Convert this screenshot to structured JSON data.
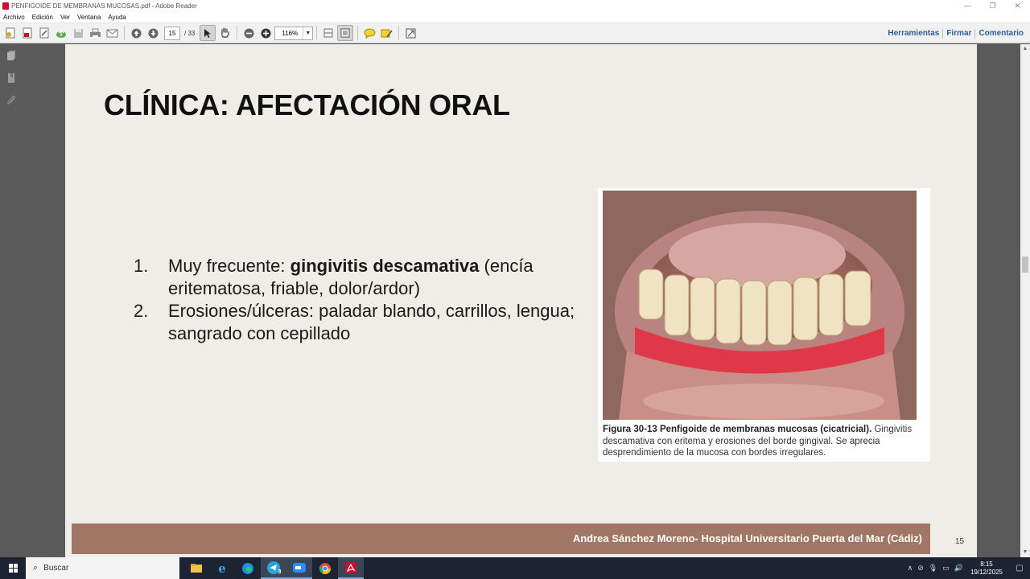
{
  "window": {
    "title": "PENFIGOIDE DE MEMBRANAS MUCOSAS.pdf - Adobe Reader",
    "controls": {
      "minimize": "—",
      "restore": "❐",
      "close": "✕"
    }
  },
  "menu": {
    "items": [
      "Archivo",
      "Edición",
      "Ver",
      "Ventana",
      "Ayuda"
    ]
  },
  "toolbar": {
    "page_current": "15",
    "page_total": "/ 33",
    "zoom": "116%",
    "right_links": [
      "Herramientas",
      "Firmar",
      "Comentario"
    ]
  },
  "slide": {
    "title": "CLÍNICA: AFECTACIÓN ORAL",
    "points": [
      {
        "num": "1.",
        "pre": "Muy frecuente: ",
        "bold": "gingivitis descamativa",
        "post": " (encía eritematosa, friable, dolor/ardor)"
      },
      {
        "num": "2.",
        "pre": "Erosiones/úlceras: paladar blando, carrillos, lengua; sangrado con cepillado",
        "bold": "",
        "post": ""
      }
    ],
    "figure": {
      "label": "Figura 30-13  Penfigoide de membranas mucosas (cicatricial).",
      "text": " Gingivitis descamativa con eritema y erosiones del borde gingival. Se aprecia desprendimiento de la mucosa con bordes irregulares."
    },
    "footer": "Andrea Sánchez Moreno- Hospital Universitario Puerta del Mar (Cádiz)",
    "page_number": "15"
  },
  "taskbar": {
    "search_placeholder": "Buscar",
    "clock_time": "8:15",
    "clock_date": "19/12/2025",
    "badge": "30"
  }
}
